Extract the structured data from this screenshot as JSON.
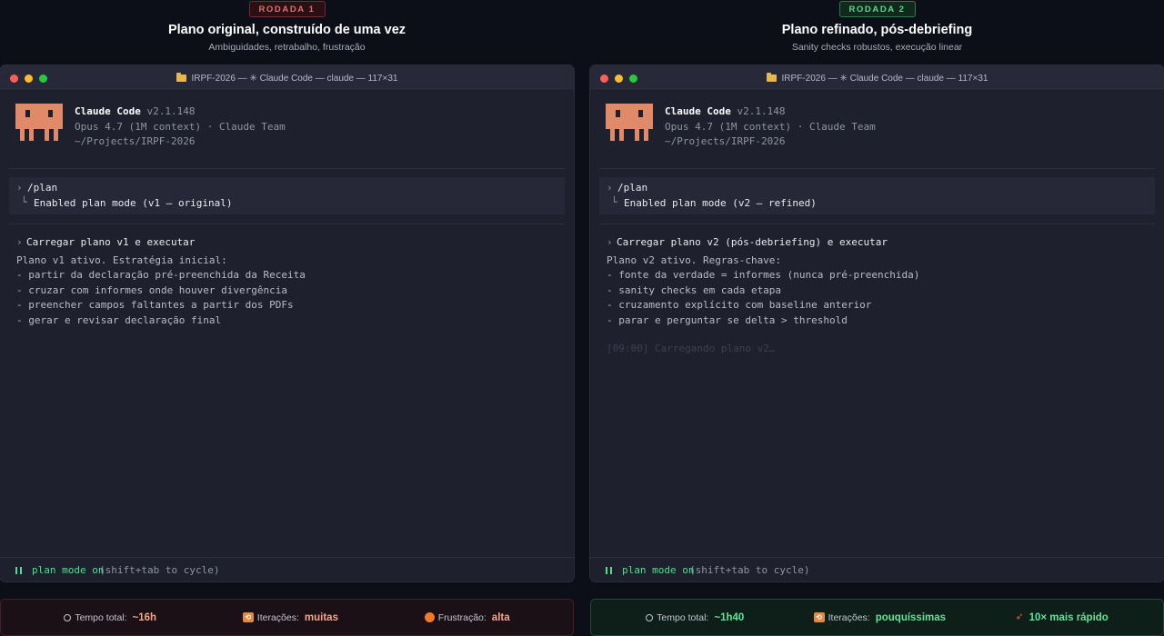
{
  "left": {
    "badge": "RODADA 1",
    "title": "Plano original, construído de uma vez",
    "subtitle": "Ambiguidades, retrabalho, frustração",
    "window_title": "IRPF-2026 — ✳ Claude Code — claude — 117×31",
    "app_name": "Claude Code",
    "version": "v2.1.148",
    "model_line": "Opus 4.7 (1M context) · Claude Team",
    "path": "~/Projects/IRPF-2026",
    "prompt_symbol": "›",
    "command": "/plan",
    "branch_symbol": "└",
    "command_result": "Enabled plan mode (v1 — original)",
    "exec_command": "Carregar plano v1 e executar",
    "plan_header": "Plano v1 ativo. Estratégia inicial:",
    "plan_items": [
      "- partir da declaração pré-preenchida da Receita",
      "- cruzar com informes onde houver divergência",
      "- preencher campos faltantes a partir dos PDFs",
      "- gerar e revisar declaração final"
    ],
    "status_on": "plan mode on",
    "status_hint": "(shift+tab to cycle)",
    "stats": [
      {
        "icon": "clock-icon",
        "label": "Tempo total:",
        "value": "~16h"
      },
      {
        "icon": "repeat-icon",
        "label": "Iterações:",
        "value": "muitas"
      },
      {
        "icon": "angry-face-icon",
        "label": "Frustração:",
        "value": "alta"
      }
    ]
  },
  "right": {
    "badge": "RODADA 2",
    "title": "Plano refinado, pós-debriefing",
    "subtitle": "Sanity checks robustos, execução linear",
    "window_title": "IRPF-2026 — ✳ Claude Code — claude — 117×31",
    "app_name": "Claude Code",
    "version": "v2.1.148",
    "model_line": "Opus 4.7 (1M context) · Claude Team",
    "path": "~/Projects/IRPF-2026",
    "prompt_symbol": "›",
    "command": "/plan",
    "branch_symbol": "└",
    "command_result": "Enabled plan mode (v2 — refined)",
    "exec_command": "Carregar plano v2 (pós-debriefing) e executar",
    "plan_header": "Plano v2 ativo. Regras-chave:",
    "plan_items": [
      "- fonte da verdade = informes (nunca pré-preenchida)",
      "- sanity checks em cada etapa",
      "- cruzamento explícito com baseline anterior",
      "- parar e perguntar se delta > threshold"
    ],
    "loading": "[09:00] Carregando plano v2…",
    "status_on": "plan mode on",
    "status_hint": "(shift+tab to cycle)",
    "stats": [
      {
        "icon": "clock-icon",
        "label": "Tempo total:",
        "value": "~1h40"
      },
      {
        "icon": "repeat-icon",
        "label": "Iterações:",
        "value": "pouquíssimas"
      },
      {
        "icon": "rocket-icon",
        "label": "",
        "value": "10× mais rápido"
      }
    ]
  },
  "colors": {
    "accent_red": "#e07070",
    "accent_green": "#5fd58e",
    "logo_orange": "#e08a6a",
    "status_green": "#4ee08a"
  }
}
